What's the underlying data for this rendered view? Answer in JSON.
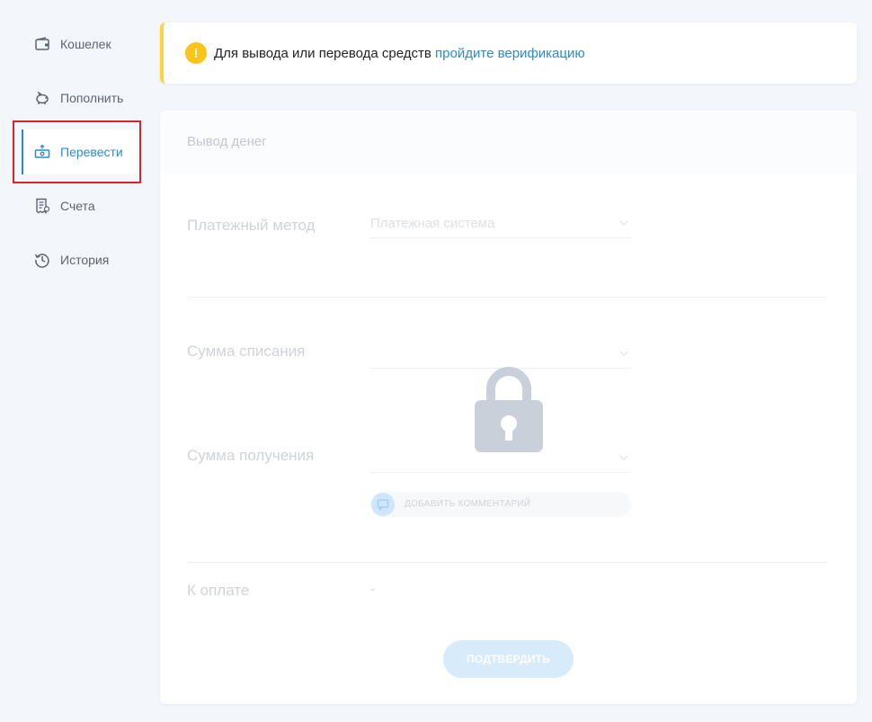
{
  "sidebar": {
    "items": [
      {
        "label": "Кошелек",
        "icon": "wallet-icon"
      },
      {
        "label": "Пополнить",
        "icon": "piggy-bank-icon"
      },
      {
        "label": "Перевести",
        "icon": "money-transfer-icon",
        "active": true
      },
      {
        "label": "Счета",
        "icon": "invoice-icon"
      },
      {
        "label": "История",
        "icon": "history-icon"
      }
    ]
  },
  "notice": {
    "icon": "info-icon",
    "text": "Для вывода или перевода средств ",
    "link": "пройдите верификацию",
    "accent": "#ffd43b"
  },
  "withdraw": {
    "title": "Вывод денег",
    "payment_method_label": "Платежный метод",
    "payment_system_placeholder": "Платежная система",
    "debit_amount_label": "Сумма списания",
    "receive_amount_label": "Сумма получения",
    "add_comment_label": "ДОБАВИТЬ КОММЕНТАРИЙ",
    "to_pay_label": "К оплате",
    "to_pay_value": "-",
    "confirm_label": "ПОДТВЕРДИТЬ",
    "lock_icon": "lock-icon"
  },
  "colors": {
    "accent": "#2b8bcc",
    "highlight": "#d9242b",
    "background": "#f3f6fb"
  }
}
